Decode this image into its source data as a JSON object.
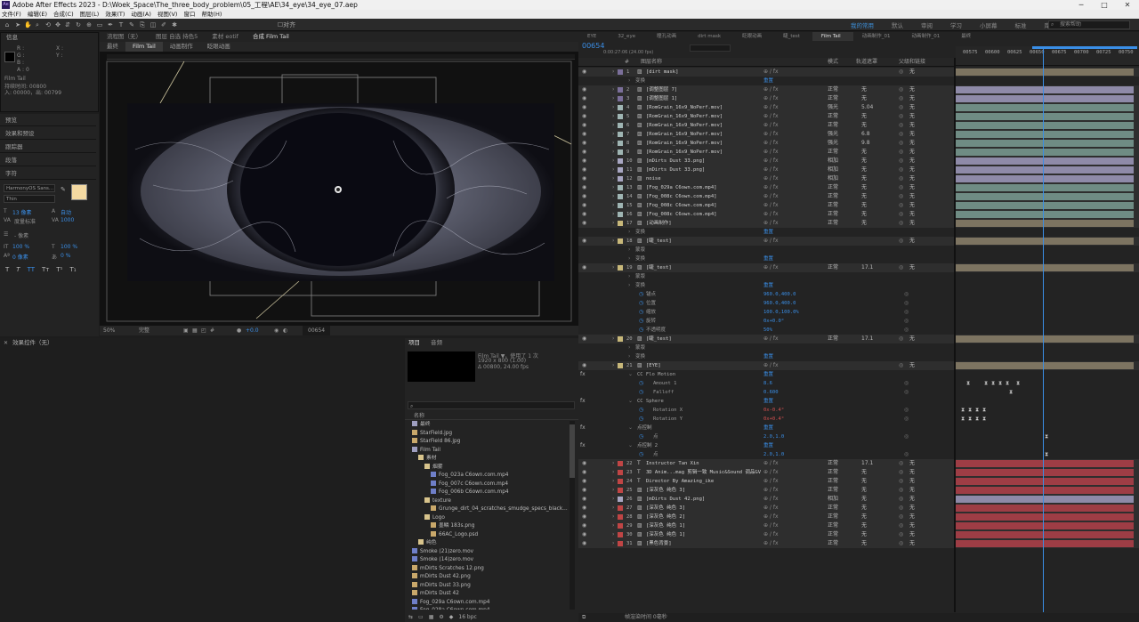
{
  "title": "Adobe After Effects 2023 - D:\\Woek_Space\\The_three_body_problem\\05_工程\\AE\\34_eye\\34_eye_07.aep",
  "menu": [
    "文件(F)",
    "编辑(E)",
    "合成(C)",
    "图层(L)",
    "效果(T)",
    "动画(A)",
    "视图(V)",
    "窗口",
    "帮助(H)"
  ],
  "workspaces": [
    "我的常用",
    "默认",
    "审阅",
    "学习",
    "小屏幕",
    "标准",
    "库"
  ],
  "workspace_active": "我的常用",
  "help_search": "搜索帮助",
  "info_panel": {
    "title": "信息",
    "r": "R :",
    "g": "G :",
    "b": "B :",
    "a": "A : 0",
    "x": "X :",
    "y": "Y :",
    "film_name": "Film Tail",
    "duration": "持续时间: 00800",
    "in_out": "入: 00000，出: 00799"
  },
  "side_sections": [
    "预览",
    "效果和预设",
    "跟踪器",
    "段落",
    "字符"
  ],
  "character": {
    "font": "HarmonyOS Sans...",
    "weight": "Thin",
    "size": "13 像素",
    "leading": "自动",
    "tracking_mode": "度量标准",
    "tracking": "1000",
    "stroke": "- 像素",
    "scale_v": "100 %",
    "scale_h": "100 %",
    "baseline": "0 像素",
    "tsume": "0 %"
  },
  "comp_tabs": {
    "flow": "流程图（无）",
    "layer": "图层 自选 持色5",
    "footage": "素材 eotif",
    "comp": "合成 Film Tail"
  },
  "comp_subtabs": [
    "最终",
    "Film Tail",
    "动画制作",
    "眨眼动画"
  ],
  "viewer": {
    "zoom": "50%",
    "quality": "完整",
    "time": "00654",
    "offset": "+0.0"
  },
  "effect_controls": {
    "title": "效果控件（无）"
  },
  "project": {
    "tabs": [
      "项目",
      "音频"
    ],
    "comp_info": "Film Tail ▼，使用了 1 次",
    "size": "1920 x 800 (1.00)",
    "dur": "Δ 00800, 24.00 fps",
    "col_name": "名称",
    "items": [
      {
        "name": "最终",
        "ind": 0,
        "kind": "comp"
      },
      {
        "name": "StarField.jpg",
        "ind": 0,
        "kind": "img"
      },
      {
        "name": "StarField 86.jpg",
        "ind": 0,
        "kind": "img"
      },
      {
        "name": "Film Tail",
        "ind": 0,
        "kind": "comp"
      },
      {
        "name": "素材",
        "ind": 1,
        "kind": "folder"
      },
      {
        "name": "烟雾",
        "ind": 2,
        "kind": "folder"
      },
      {
        "name": "Fog_023a C6own.com.mp4",
        "ind": 3,
        "kind": "vid"
      },
      {
        "name": "Fog_007c C6own.com.mp4",
        "ind": 3,
        "kind": "vid"
      },
      {
        "name": "Fog_006b C6own.com.mp4",
        "ind": 3,
        "kind": "vid"
      },
      {
        "name": "texture",
        "ind": 2,
        "kind": "folder"
      },
      {
        "name": "Grunge_dirt_04_scratches_smudge_specs_black...",
        "ind": 3,
        "kind": "img"
      },
      {
        "name": "Logo",
        "ind": 2,
        "kind": "folder"
      },
      {
        "name": "墨鳞 183s.png",
        "ind": 3,
        "kind": "img"
      },
      {
        "name": "66AC_Logo.psd",
        "ind": 3,
        "kind": "img"
      },
      {
        "name": "纯色",
        "ind": 1,
        "kind": "folder"
      },
      {
        "name": "Smoke (21)zero.mov",
        "ind": 0,
        "kind": "vid"
      },
      {
        "name": "Smoke (14)zero.mov",
        "ind": 0,
        "kind": "vid"
      },
      {
        "name": "mDirts Scratches 12.png",
        "ind": 0,
        "kind": "img"
      },
      {
        "name": "mDirts Dust 42.png",
        "ind": 0,
        "kind": "img"
      },
      {
        "name": "mDirts Dust 33.png",
        "ind": 0,
        "kind": "img"
      },
      {
        "name": "mDirts Dust 42",
        "ind": 0,
        "kind": "img"
      },
      {
        "name": "Fog_029a C6own.com.mp4",
        "ind": 0,
        "kind": "vid"
      },
      {
        "name": "Fog_028a C6own.com.mp4",
        "ind": 0,
        "kind": "vid"
      }
    ],
    "bpc": "16 bpc"
  },
  "timeline": {
    "tabs": [
      "EYE",
      "32_eye",
      "瞳孔动画",
      "dirt mask",
      "眨眼动画",
      "睫_test",
      "Film Tail",
      "动画制作_01",
      "动画制作_01",
      "最终"
    ],
    "active_tab": "Film Tail",
    "current_time": "00654",
    "time_sub": "0:00:27:06 (24.00 fps)",
    "cols": {
      "num": "#",
      "name": "图层名称",
      "mode": "模式",
      "track": "轨道遮罩",
      "parent": "父级和链接"
    },
    "ruler": [
      "00575",
      "00600",
      "00625",
      "00650",
      "00675",
      "00700",
      "00725",
      "00750"
    ],
    "footer": "帧渲染时间 0毫秒",
    "rows": [
      {
        "t": "layer",
        "n": "1",
        "name": "[dirt mask]",
        "c": "#7b6f9a",
        "bar": "#7d7461",
        "mode": "",
        "track": "",
        "parent": "无"
      },
      {
        "t": "prop",
        "name": "变换",
        "val": "重置"
      },
      {
        "t": "layer",
        "n": "2",
        "name": "[调整图层 7]",
        "c": "#7b6f9a",
        "bar": "#8e8aa8",
        "mode": "正常",
        "track": "无",
        "parent": "无"
      },
      {
        "t": "layer",
        "n": "3",
        "name": "[调整图层 1]",
        "c": "#7b6f9a",
        "bar": "#8e8aa8",
        "mode": "正常",
        "track": "无",
        "parent": "无"
      },
      {
        "t": "layer",
        "n": "4",
        "name": "[RomGrain_16x9_NoPerf.mov]",
        "c": "#9fb5b3",
        "bar": "#6f8c84",
        "mode": "强光",
        "track": "5.04",
        "parent": "无"
      },
      {
        "t": "layer",
        "n": "5",
        "name": "[RomGrain_16x9_NoPerf.mov]",
        "c": "#9fb5b3",
        "bar": "#6f8c84",
        "mode": "正常",
        "track": "无",
        "parent": "无"
      },
      {
        "t": "layer",
        "n": "6",
        "name": "[RomGrain_16x9_NoPerf.mov]",
        "c": "#9fb5b3",
        "bar": "#6f8c84",
        "mode": "正常",
        "track": "无",
        "parent": "无"
      },
      {
        "t": "layer",
        "n": "7",
        "name": "[RomGrain_16x9_NoPerf.mov]",
        "c": "#9fb5b3",
        "bar": "#6f8c84",
        "mode": "强光",
        "track": "6.8",
        "parent": "无"
      },
      {
        "t": "layer",
        "n": "8",
        "name": "[RomGrain_16x9_NoPerf.mov]",
        "c": "#9fb5b3",
        "bar": "#6f8c84",
        "mode": "强光",
        "track": "9.8",
        "parent": "无"
      },
      {
        "t": "layer",
        "n": "9",
        "name": "[RomGrain_16x9_NoPerf.mov]",
        "c": "#9fb5b3",
        "bar": "#6f8c84",
        "mode": "正常",
        "track": "无",
        "parent": "无"
      },
      {
        "t": "layer",
        "n": "10",
        "name": "[mDirts Dust 33.png]",
        "c": "#a8a6c2",
        "bar": "#8e8aa8",
        "mode": "相加",
        "track": "无",
        "parent": "无"
      },
      {
        "t": "layer",
        "n": "11",
        "name": "[mDirts Dust 33.png]",
        "c": "#a8a6c2",
        "bar": "#8e8aa8",
        "mode": "相加",
        "track": "无",
        "parent": "无"
      },
      {
        "t": "layer",
        "n": "12",
        "name": "noise",
        "c": "#a8a6c2",
        "bar": "#8e8aa8",
        "mode": "相加",
        "track": "无",
        "parent": "无"
      },
      {
        "t": "layer",
        "n": "13",
        "name": "[Fog_029a C6own.com.mp4]",
        "c": "#9fb5b3",
        "bar": "#6f8c84",
        "mode": "正常",
        "track": "无",
        "parent": "无"
      },
      {
        "t": "layer",
        "n": "14",
        "name": "[Fog_008c C6own.com.mp4]",
        "c": "#9fb5b3",
        "bar": "#6f8c84",
        "mode": "正常",
        "track": "无",
        "parent": "无"
      },
      {
        "t": "layer",
        "n": "15",
        "name": "[Fog_008c C6own.com.mp4]",
        "c": "#9fb5b3",
        "bar": "#6f8c84",
        "mode": "正常",
        "track": "无",
        "parent": "无"
      },
      {
        "t": "layer",
        "n": "16",
        "name": "[Fog_008c C6own.com.mp4]",
        "c": "#9fb5b3",
        "bar": "#6f8c84",
        "mode": "正常",
        "track": "无",
        "parent": "无"
      },
      {
        "t": "layer",
        "n": "17",
        "name": "[动画制作]",
        "c": "#c8b87a",
        "bar": "#7d7461",
        "mode": "正常",
        "track": "无",
        "parent": "无"
      },
      {
        "t": "prop",
        "name": "变换",
        "val": "重置"
      },
      {
        "t": "layer",
        "n": "18",
        "name": "[睫_test]",
        "c": "#c8b87a",
        "bar": "#7d7461",
        "mode": "",
        "track": "",
        "parent": "无"
      },
      {
        "t": "prop",
        "name": "蒙版",
        "val": ""
      },
      {
        "t": "prop",
        "name": "变换",
        "val": "重置"
      },
      {
        "t": "layer",
        "n": "19",
        "name": "[睫_test]",
        "c": "#c8b87a",
        "bar": "#7d7461",
        "mode": "正常",
        "track": "17.1",
        "parent": "无"
      },
      {
        "t": "prop",
        "name": "蒙版",
        "val": ""
      },
      {
        "t": "prop",
        "name": "变换",
        "val": "重置"
      },
      {
        "t": "sub",
        "name": "锚点",
        "val": "960.0,400.0"
      },
      {
        "t": "sub",
        "name": "位置",
        "val": "960.0,400.0"
      },
      {
        "t": "sub",
        "name": "缩放",
        "val": "100.0,100.0%"
      },
      {
        "t": "sub",
        "name": "旋转",
        "val": "0x+0.0°"
      },
      {
        "t": "sub",
        "name": "不透明度",
        "val": "50%"
      },
      {
        "t": "layer",
        "n": "20",
        "name": "[睫_test]",
        "c": "#c8b87a",
        "bar": "#7d7461",
        "mode": "正常",
        "track": "17.1",
        "parent": "无"
      },
      {
        "t": "prop",
        "name": "蒙版",
        "val": ""
      },
      {
        "t": "prop",
        "name": "变换",
        "val": "重置"
      },
      {
        "t": "layer",
        "n": "21",
        "name": "[EYE]",
        "c": "#c8b87a",
        "bar": "#7d7461",
        "mode": "",
        "track": "",
        "parent": "无"
      },
      {
        "t": "fx",
        "name": "CC Flo Motion",
        "val": "重置"
      },
      {
        "t": "sub2",
        "name": "Amount 1",
        "val": "8.6",
        "kf": [
          8,
          28,
          36,
          44,
          52,
          64
        ]
      },
      {
        "t": "sub2",
        "name": "Falloff",
        "val": "0.600",
        "kf": [
          56
        ]
      },
      {
        "t": "fx",
        "name": "CC Sphere",
        "val": "重置"
      },
      {
        "t": "sub2",
        "name": "Rotation X",
        "val": "0x-0.4°",
        "red": true,
        "kf": [
          2,
          10,
          18,
          26
        ]
      },
      {
        "t": "sub2",
        "name": "Rotation Y",
        "val": "0x+0.4°",
        "red": true,
        "kf": [
          2,
          10,
          18,
          26
        ]
      },
      {
        "t": "fx",
        "name": "点控制",
        "val": "重置"
      },
      {
        "t": "sub2",
        "name": "点",
        "val": "2.0,1.0",
        "kf": [
          96
        ]
      },
      {
        "t": "fx",
        "name": "点控制 2",
        "val": "重置"
      },
      {
        "t": "sub2",
        "name": "点",
        "val": "2.0,1.0",
        "kf": [
          96
        ]
      },
      {
        "t": "layer",
        "n": "22",
        "name": "Instructor  Tan Xin",
        "c": "#c04545",
        "bar": "#9e3d45",
        "mode": "正常",
        "track": "17.1",
        "parent": "无",
        "text": true
      },
      {
        "t": "layer",
        "n": "23",
        "name": "3D Anim...mag 剪辑一致  Music&Sound 调品GV",
        "c": "#c04545",
        "bar": "#9e3d45",
        "mode": "正常",
        "track": "无",
        "parent": "无",
        "text": true
      },
      {
        "t": "layer",
        "n": "24",
        "name": "Director By  Amazing_ike",
        "c": "#c04545",
        "bar": "#9e3d45",
        "mode": "正常",
        "track": "无",
        "parent": "无",
        "text": true
      },
      {
        "t": "layer",
        "n": "25",
        "name": "[深灰色 纯色 3]",
        "c": "#c04545",
        "bar": "#9e3d45",
        "mode": "正常",
        "track": "无",
        "parent": "无"
      },
      {
        "t": "layer",
        "n": "26",
        "name": "[mDirts Dust 42.png]",
        "c": "#a8a6c2",
        "bar": "#8e8aa8",
        "mode": "相加",
        "track": "无",
        "parent": "无"
      },
      {
        "t": "layer",
        "n": "27",
        "name": "[深灰色 纯色 3]",
        "c": "#c04545",
        "bar": "#9e3d45",
        "mode": "正常",
        "track": "无",
        "parent": "无"
      },
      {
        "t": "layer",
        "n": "28",
        "name": "[深灰色 纯色 2]",
        "c": "#c04545",
        "bar": "#9e3d45",
        "mode": "正常",
        "track": "无",
        "parent": "无"
      },
      {
        "t": "layer",
        "n": "29",
        "name": "[深灰色 纯色 1]",
        "c": "#c04545",
        "bar": "#9e3d45",
        "mode": "正常",
        "track": "无",
        "parent": "无"
      },
      {
        "t": "layer",
        "n": "30",
        "name": "[深灰色 纯色 1]",
        "c": "#c04545",
        "bar": "#9e3d45",
        "mode": "正常",
        "track": "无",
        "parent": "无"
      },
      {
        "t": "layer",
        "n": "31",
        "name": "[黑色背景]",
        "c": "#c04545",
        "bar": "#9e3d45",
        "mode": "正常",
        "track": "无",
        "parent": "无"
      }
    ]
  }
}
